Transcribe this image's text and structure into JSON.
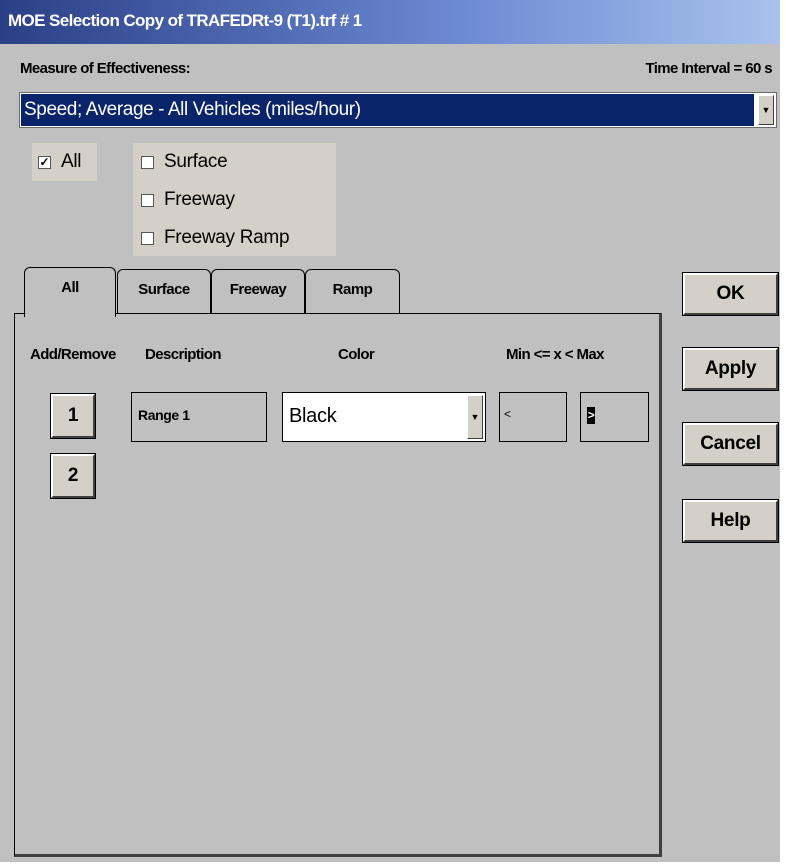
{
  "window": {
    "title": "MOE Selection  Copy of TRAFEDRt-9 (T1).trf # 1"
  },
  "header": {
    "moe_label": "Measure of Effectiveness:",
    "interval_label": "Time Interval = 60 s"
  },
  "moe_select": {
    "value": "Speed; Average - All Vehicles (miles/hour)"
  },
  "filters": [
    {
      "label": "All",
      "checked": true,
      "mark": "✓"
    },
    {
      "label": "Surface",
      "checked": false,
      "mark": ""
    },
    {
      "label": "Freeway",
      "checked": false,
      "mark": ""
    },
    {
      "label": "Freeway Ramp",
      "checked": false,
      "mark": ""
    }
  ],
  "tabs": [
    {
      "label": "All",
      "active": true
    },
    {
      "label": "Surface",
      "active": false
    },
    {
      "label": "Freeway",
      "active": false
    },
    {
      "label": "Ramp",
      "active": false
    }
  ],
  "columns": {
    "add_remove": "Add/Remove",
    "description": "Description",
    "color": "Color",
    "range": "Min <= x < Max"
  },
  "ranges": [
    {
      "button": "1",
      "description": "Range 1",
      "color": "Black",
      "min": "<",
      "max": ">"
    }
  ],
  "add_button": "2",
  "buttons": {
    "ok": "OK",
    "apply": "Apply",
    "cancel": "Cancel",
    "help": "Help"
  }
}
